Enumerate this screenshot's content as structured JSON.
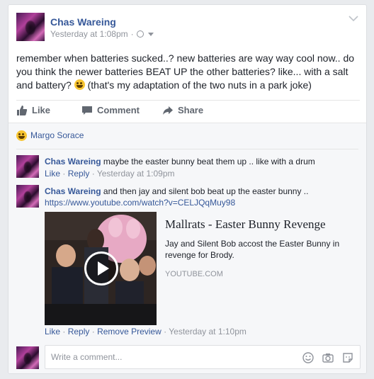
{
  "post": {
    "author": "Chas Wareing",
    "timestamp": "Yesterday at 1:08pm",
    "separator": "·",
    "privacy_icon": "globe-icon",
    "body_before_emoji": "remember when batteries sucked..? new batteries are way way cool now.. do you think the newer batteries BEAT UP the other batteries? like... with a salt and battery?",
    "body_after_emoji": "(that's my adaptation of the two nuts in a park joke)"
  },
  "actions": {
    "like": "Like",
    "comment": "Comment",
    "share": "Share"
  },
  "reactions": {
    "reactor": "Margo Sorace"
  },
  "comments": [
    {
      "author": "Chas Wareing",
      "text": "maybe the easter bunny beat them up .. like with a drum",
      "like": "Like",
      "reply": "Reply",
      "time": "Yesterday at 1:09pm"
    },
    {
      "author": "Chas Wareing",
      "text": "and then jay and silent bob beat up the easter bunny ..",
      "url": "https://www.youtube.com/watch?v=CELJQqMuy98",
      "like": "Like",
      "reply": "Reply",
      "remove_preview": "Remove Preview",
      "time": "Yesterday at 1:10pm"
    }
  ],
  "preview": {
    "title": "Mallrats - Easter Bunny Revenge",
    "description": "Jay and Silent Bob accost the Easter Bunny in revenge for Brody.",
    "domain": "YOUTUBE.COM"
  },
  "composer": {
    "placeholder": "Write a comment..."
  },
  "colors": {
    "link": "#365899",
    "muted": "#90949c",
    "page_bg": "#e9ebee"
  }
}
